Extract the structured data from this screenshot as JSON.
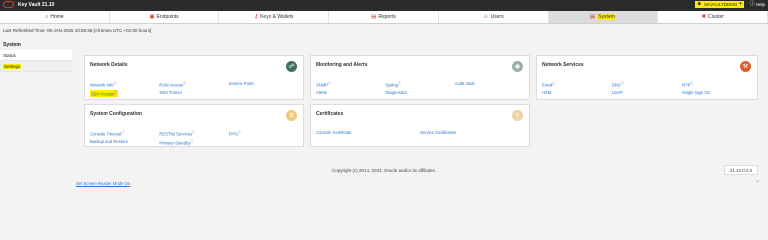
{
  "app": {
    "name": "Key Vault 21.10"
  },
  "user": {
    "name": "SKVAULTDEMO",
    "help": "Help"
  },
  "nav": {
    "tabs": [
      {
        "label": "Home",
        "icon": "home-icon"
      },
      {
        "label": "Endpoints",
        "icon": "endpoints-icon"
      },
      {
        "label": "Keys & Wallets",
        "icon": "keys-icon"
      },
      {
        "label": "Reports",
        "icon": "reports-icon"
      },
      {
        "label": "Users",
        "icon": "users-icon"
      },
      {
        "label": "System",
        "icon": "system-icon"
      },
      {
        "label": "Cluster",
        "icon": "cluster-icon"
      }
    ],
    "active": "System"
  },
  "refresh": {
    "text": "Last Refreshed Time: 06-JAN-2025 10:59:35 [All times UTC +01:00 hours]"
  },
  "sidebar": {
    "title": "System",
    "items": [
      {
        "label": "Status"
      },
      {
        "label": "Settings"
      }
    ]
  },
  "cards": {
    "network_details": {
      "title": "Network Details",
      "links": [
        {
          "label": "Network Info",
          "sup": "ⓘ"
        },
        {
          "label": "RAM Access",
          "sup": "ⓘ"
        },
        {
          "label": "Service Ports",
          "sup": ""
        },
        {
          "label": "SSH Access",
          "sup": "ⓘ"
        },
        {
          "label": "SSH Tunnel",
          "sup": ""
        }
      ]
    },
    "monitoring": {
      "title": "Monitoring and Alerts",
      "links": [
        {
          "label": "SNMP",
          "sup": "ⓘ"
        },
        {
          "label": "Syslog",
          "sup": "ⓘ"
        },
        {
          "label": "Audit Vault",
          "sup": ""
        },
        {
          "label": "Alerts",
          "sup": ""
        },
        {
          "label": "Diagnostics",
          "sup": ""
        }
      ]
    },
    "network_services": {
      "title": "Network Services",
      "links": [
        {
          "label": "Email",
          "sup": "ⓘ"
        },
        {
          "label": "DNS",
          "sup": "ⓘ"
        },
        {
          "label": "NTP",
          "sup": "ⓘ"
        },
        {
          "label": "HSM",
          "sup": ""
        },
        {
          "label": "LDAP",
          "sup": ""
        },
        {
          "label": "Single Sign On",
          "sup": ""
        }
      ]
    },
    "system_config": {
      "title": "System Configuration",
      "links": [
        {
          "label": "Console Timeout",
          "sup": "ⓘ"
        },
        {
          "label": "RESTful Services",
          "sup": "ⓘ"
        },
        {
          "label": "FIPS",
          "sup": "ⓘ"
        },
        {
          "label": "Backup and Restore",
          "sup": ""
        },
        {
          "label": "Primary-Standby",
          "sup": "ⓘ"
        }
      ]
    },
    "certificates": {
      "title": "Certificates",
      "links": [
        {
          "label": "Console Certificate",
          "sup": ""
        },
        {
          "label": "Service Certificates",
          "sup": ""
        }
      ]
    }
  },
  "footer": {
    "copyright": "Copyright (c) 2014, 2024, Oracle and/or its affiliates.",
    "version": "21.10.0.0.0",
    "screen_reader": "Set Screen Reader Mode On"
  },
  "colors": {
    "highlight": "#ffea00",
    "link": "#2a73c9",
    "network_badge": "#3f6f63",
    "monitor_badge": "#9bb0a8",
    "services_badge": "#d9602f",
    "config_badge": "#f2c77c",
    "cert_badge": "#ecd3a4"
  }
}
